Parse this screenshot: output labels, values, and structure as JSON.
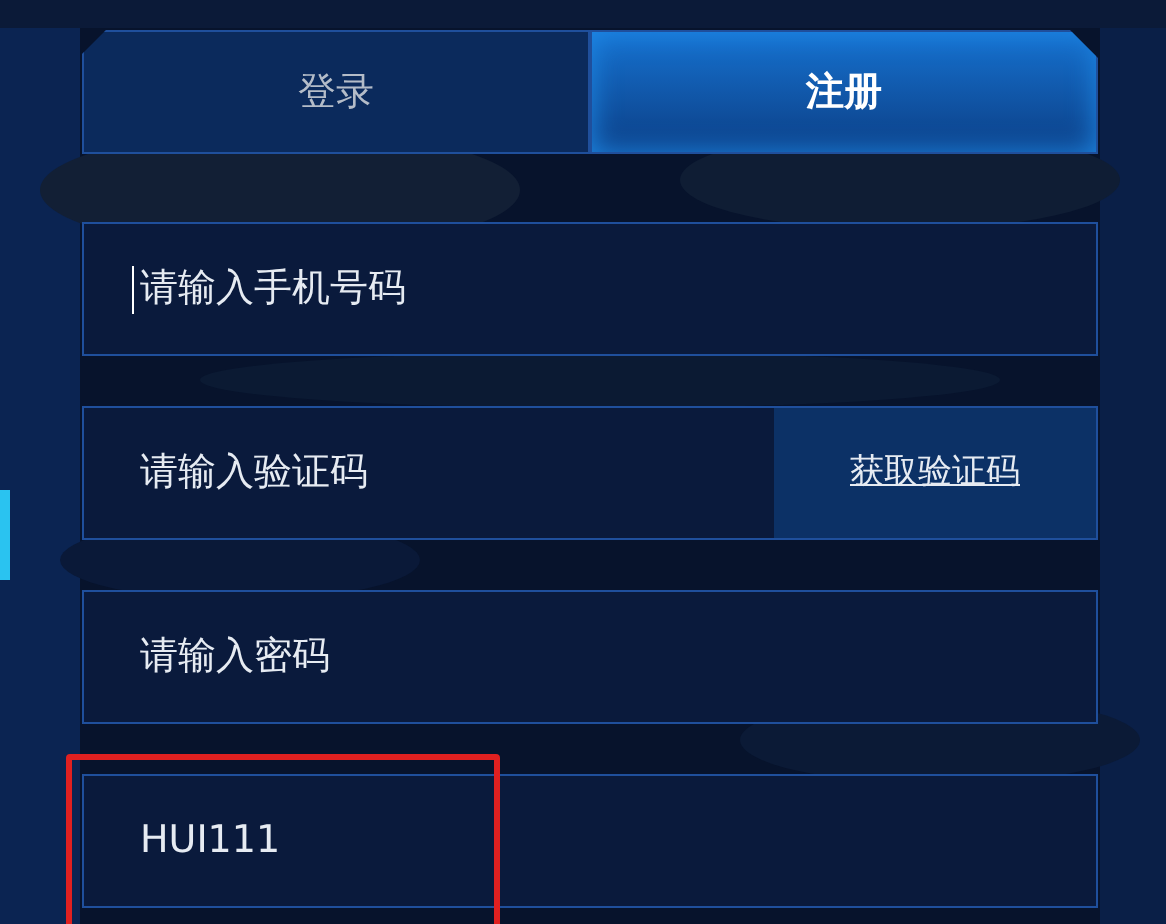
{
  "tabs": [
    {
      "label": "登录",
      "selected": false
    },
    {
      "label": "注册",
      "selected": true
    }
  ],
  "fields": [
    {
      "kind": "text",
      "placeholder": "请输入手机号码",
      "focused": true,
      "highlighted": false
    },
    {
      "kind": "code",
      "placeholder": "请输入验证码",
      "button": "获取验证码",
      "focused": false,
      "highlighted": false
    },
    {
      "kind": "password",
      "placeholder": "请输入密码",
      "focused": false,
      "highlighted": false
    },
    {
      "kind": "text",
      "value": "HUI111",
      "focused": false,
      "highlighted": true
    }
  ]
}
